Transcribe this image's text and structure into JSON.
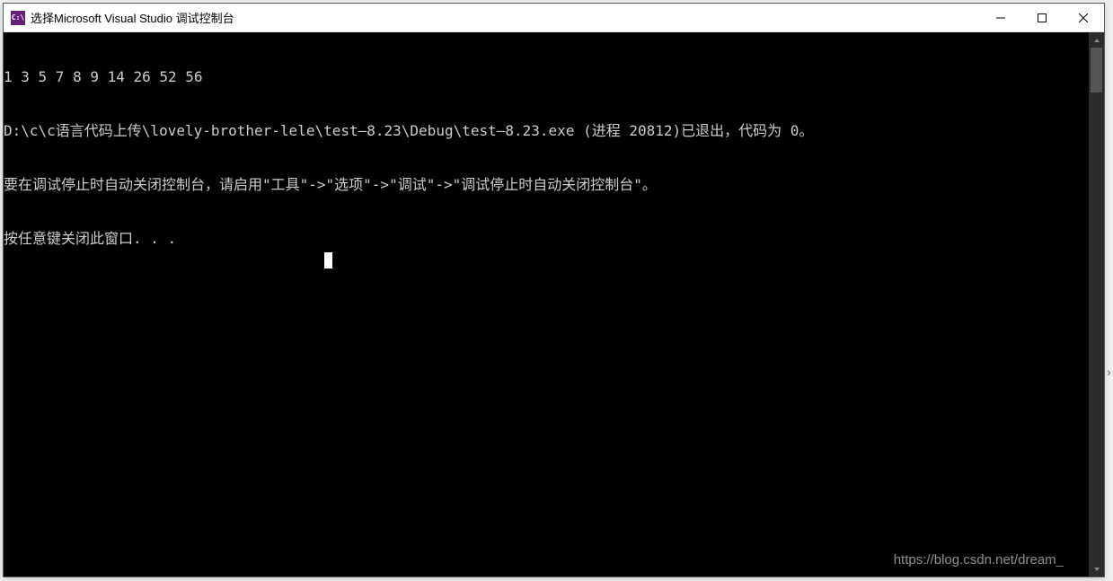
{
  "titlebar": {
    "icon_label": "C:\\",
    "title": "选择Microsoft Visual Studio 调试控制台"
  },
  "console": {
    "lines": [
      "1 3 5 7 8 9 14 26 52 56",
      "D:\\c\\c语言代码上传\\lovely-brother-lele\\test—8.23\\Debug\\test—8.23.exe (进程 20812)已退出，代码为 0。",
      "要在调试停止时自动关闭控制台，请启用\"工具\"->\"选项\"->\"调试\"->\"调试停止时自动关闭控制台\"。",
      "按任意键关闭此窗口. . ."
    ]
  },
  "watermark": "https://blog.csdn.net/dream_"
}
